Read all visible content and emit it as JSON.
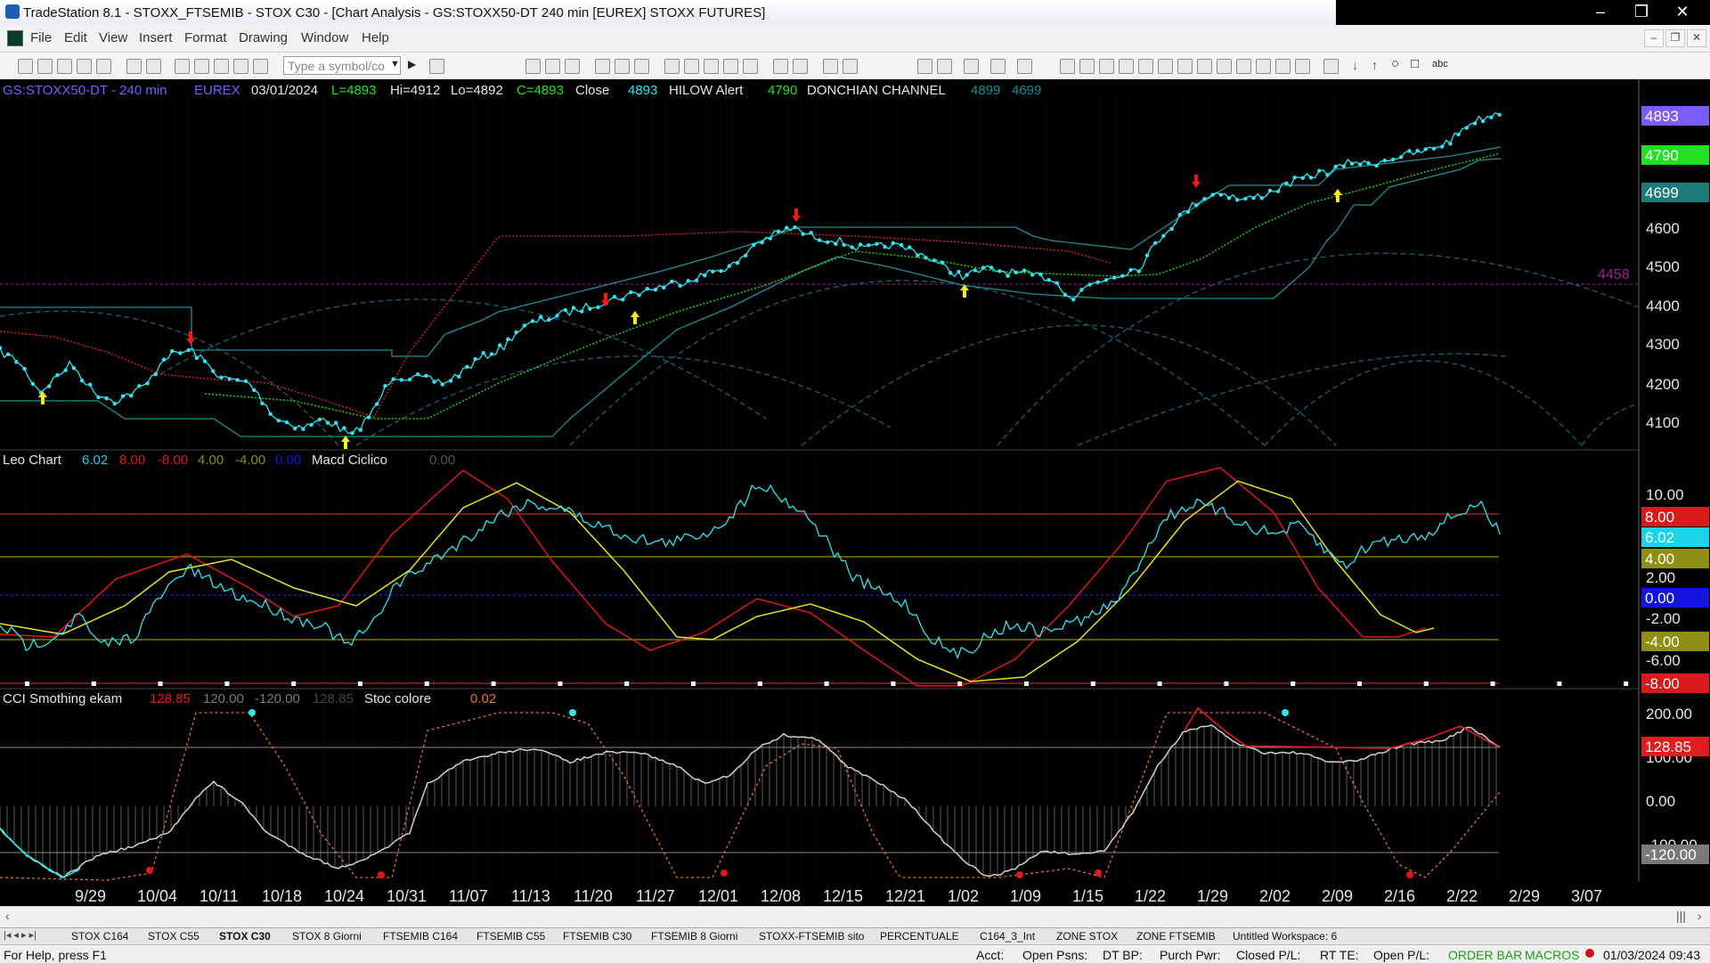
{
  "window": {
    "title": "TradeStation 8.1 - STOXX_FTSEMIB - STOX  C30 - [Chart Analysis - GS:STOXX50-DT  240 min  [EUREX] STOXX FUTURES]",
    "minimize": "‒",
    "restore": "❐",
    "close": "✕"
  },
  "menu": [
    "File",
    "Edit",
    "View",
    "Insert",
    "Format",
    "Drawing",
    "Window",
    "Help"
  ],
  "toolbar": {
    "symbol_placeholder": "Type a symbol/co"
  },
  "header": {
    "symbol": "GS:STOXX50-DT - 240 min",
    "exchange": "EUREX",
    "date": "03/01/2024",
    "last": "L=4893",
    "high": "Hi=4912",
    "low": "Lo=4892",
    "close": "C=4893",
    "close_label": "Close",
    "close_value": "4893",
    "hilow_label": "HILOW Alert",
    "hilow_value": "4790",
    "donchian_label": "DONCHIAN CHANNEL",
    "donchian_upper": "4899",
    "donchian_lower": "4699",
    "marker_level": "4458"
  },
  "price_axis": {
    "ticks": [
      "4600",
      "4500",
      "4400",
      "4300",
      "4200",
      "4100"
    ],
    "tags": [
      {
        "text": "4893",
        "color": "#7b5cff"
      },
      {
        "text": "4790",
        "color": "#22e022"
      },
      {
        "text": "4699",
        "color": "#1b7b7b"
      }
    ]
  },
  "osc1": {
    "name": "Leo Chart",
    "v1": "6.02",
    "v2": "8.00",
    "v3": "-8.00",
    "v4": "4.00",
    "v5": "-4.00",
    "v6": "0.00",
    "name2": "Macd Ciclico",
    "v7": "0.00",
    "ticks": [
      "10.00",
      "2.00",
      "-2.00",
      "-6.00"
    ],
    "tags": [
      {
        "text": "8.00",
        "color": "#d91a1a"
      },
      {
        "text": "6.02",
        "color": "#17d4ea"
      },
      {
        "text": "4.00",
        "color": "#8f8f14"
      },
      {
        "text": "0.00",
        "color": "#1414e0"
      },
      {
        "text": "-4.00",
        "color": "#8f8f14"
      },
      {
        "text": "-8.00",
        "color": "#d91a1a"
      }
    ]
  },
  "osc2": {
    "name": "CCI Smothing ekam",
    "v1": "128.85",
    "v2": "120.00",
    "v3": "-120.00",
    "v4": "128.85",
    "name2": "Stoc colore",
    "v5": "0.02",
    "ticks": [
      "200.00",
      "100.00",
      "0.00",
      "-100.00"
    ],
    "tags": [
      {
        "text": "128.85",
        "color": "#e31d1d"
      },
      {
        "text": "-120.00",
        "color": "#7a7a7a"
      }
    ]
  },
  "date_axis": [
    "9/29",
    "10/04",
    "10/11",
    "10/18",
    "10/24",
    "10/31",
    "11/07",
    "11/13",
    "11/20",
    "11/27",
    "12/01",
    "12/08",
    "12/15",
    "12/21",
    "1/02",
    "1/09",
    "1/15",
    "1/22",
    "1/29",
    "2/02",
    "2/09",
    "2/16",
    "2/22",
    "2/29",
    "3/07"
  ],
  "workspace_tabs": [
    "STOX C164",
    "STOX C55",
    "STOX  C30",
    "STOX  8 Giorni",
    "FTSEMIB C164",
    "FTSEMIB C55",
    "FTSEMIB C30",
    "FTSEMIB  8 Giorni",
    "STOXX-FTSEMIB sito",
    "PERCENTUALE",
    "C164_3_Int",
    "ZONE STOX",
    "ZONE FTSEMIB",
    "Untitled Workspace:  6"
  ],
  "status": {
    "help": "For Help, press F1",
    "acct": "Acct:",
    "open_psns": "Open Psns:",
    "dt_bp": "DT BP:",
    "purch_pwr": "Purch Pwr:",
    "closed_pl": "Closed P/L:",
    "rt_te": "RT TE:",
    "open_pl": "Open P/L:",
    "order_bar": "ORDER BAR",
    "macros": "MACROS",
    "datetime": "01/03/2024 09:43"
  },
  "colors": {
    "price": "#2ee6f0",
    "donchian": "#1f9aa0",
    "avg_red": "#d42020",
    "avg_green": "#20d020",
    "sine_red": "#e01818",
    "sine_yellow": "#e6e61e",
    "cci_white": "#d0d0d0",
    "stoc_orange": "#e07820"
  }
}
